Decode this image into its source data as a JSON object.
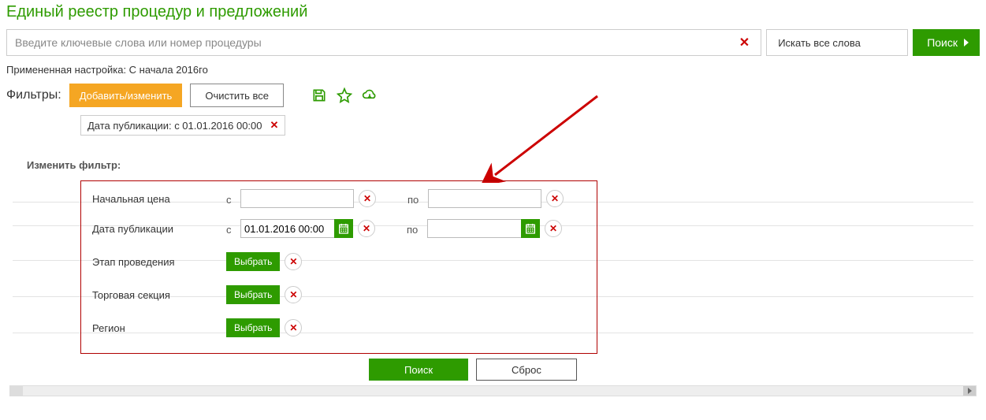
{
  "page_title": "Единый реестр процедур и предложений",
  "search": {
    "placeholder": "Введите ключевые слова или номер процедуры",
    "mode_label": "Искать все слова",
    "button_label": "Поиск"
  },
  "applied_note": "Примененная настройка: С начала 2016го",
  "filters": {
    "label": "Фильтры:",
    "add_edit": "Добавить/изменить",
    "clear_all": "Очистить все",
    "tag_text": "Дата публикации: с 01.01.2016 00:00"
  },
  "filter_panel": {
    "title": "Изменить фильтр:",
    "rows": {
      "price": {
        "label": "Начальная цена",
        "from_prefix": "с",
        "to_prefix": "по",
        "from_value": "",
        "to_value": ""
      },
      "pub_date": {
        "label": "Дата публикации",
        "from_prefix": "с",
        "to_prefix": "по",
        "from_value": "01.01.2016 00:00",
        "to_value": ""
      },
      "stage": {
        "label": "Этап проведения",
        "select_label": "Выбрать"
      },
      "section": {
        "label": "Торговая секция",
        "select_label": "Выбрать"
      },
      "region": {
        "label": "Регион",
        "select_label": "Выбрать"
      }
    },
    "actions": {
      "search": "Поиск",
      "reset": "Сброс"
    }
  }
}
